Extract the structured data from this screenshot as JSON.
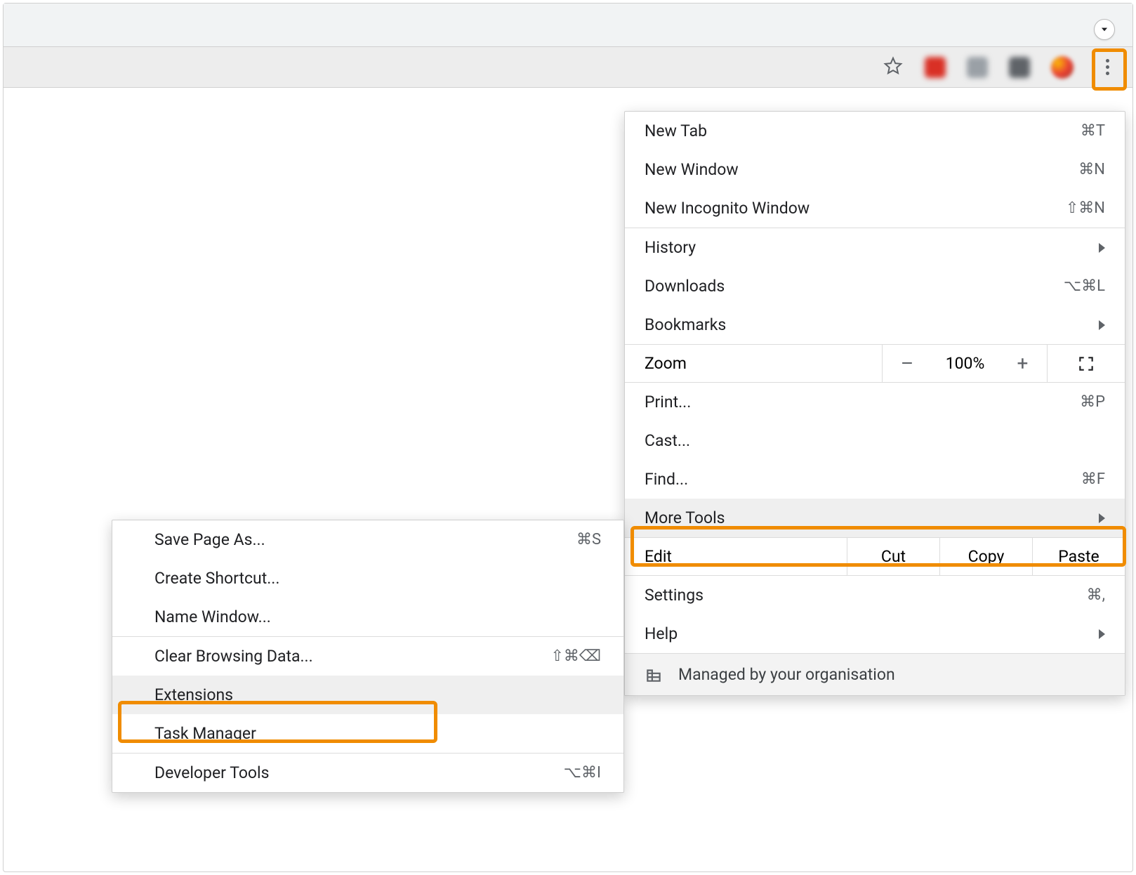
{
  "main_menu": {
    "group1": [
      {
        "label": "New Tab",
        "shortcut": "⌘T"
      },
      {
        "label": "New Window",
        "shortcut": "⌘N"
      },
      {
        "label": "New Incognito Window",
        "shortcut": "⇧⌘N"
      }
    ],
    "group2_history": "History",
    "group2_downloads": {
      "label": "Downloads",
      "shortcut": "⌥⌘L"
    },
    "group2_bookmarks": "Bookmarks",
    "zoom": {
      "label": "Zoom",
      "value": "100%",
      "minus": "–",
      "plus": "+"
    },
    "group3": [
      {
        "label": "Print...",
        "shortcut": "⌘P"
      },
      {
        "label": "Cast...",
        "shortcut": ""
      },
      {
        "label": "Find...",
        "shortcut": "⌘F"
      }
    ],
    "more_tools": "More Tools",
    "edit": {
      "label": "Edit",
      "cut": "Cut",
      "copy": "Copy",
      "paste": "Paste"
    },
    "settings": {
      "label": "Settings",
      "shortcut": "⌘,"
    },
    "help": "Help",
    "managed": "Managed by your organisation"
  },
  "sub_menu": {
    "group1": [
      {
        "label": "Save Page As...",
        "shortcut": "⌘S"
      },
      {
        "label": "Create Shortcut...",
        "shortcut": ""
      },
      {
        "label": "Name Window...",
        "shortcut": ""
      }
    ],
    "group2": [
      {
        "label": "Clear Browsing Data...",
        "shortcut": "⇧⌘⌫"
      },
      {
        "label": "Extensions",
        "shortcut": ""
      },
      {
        "label": "Task Manager",
        "shortcut": ""
      }
    ],
    "group3": [
      {
        "label": "Developer Tools",
        "shortcut": "⌥⌘I"
      }
    ]
  }
}
